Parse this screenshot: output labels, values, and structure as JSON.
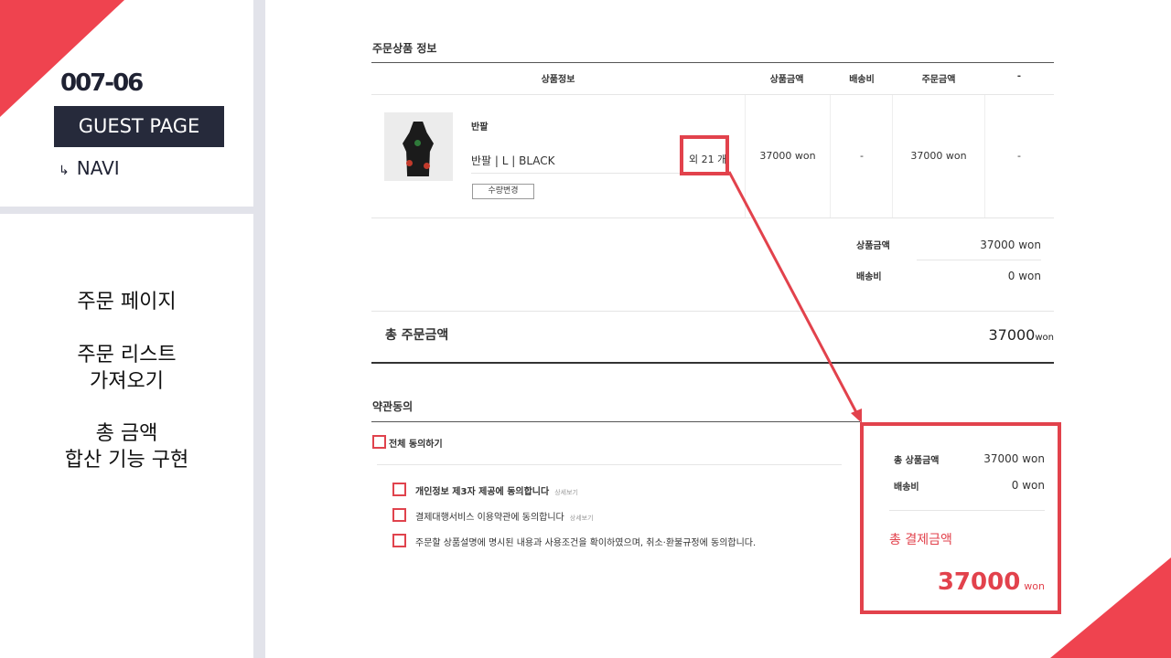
{
  "slide": {
    "code": "007-06",
    "badge": "GUEST PAGE",
    "navi": "NAVI",
    "desc": [
      "주문 페이지",
      "주문 리스트\n가져오기",
      "총 금액\n합산 기능 구현"
    ]
  },
  "order": {
    "section_title": "주문상품 정보",
    "headers": [
      "상품정보",
      "상품금액",
      "배송비",
      "주문금액",
      "-"
    ],
    "item": {
      "name": "반팔",
      "option": "반팔 | L | BLACK",
      "extra_qty": "외 21 개",
      "qty_button": "수량변경",
      "price": "37000 won",
      "shipping": "-",
      "order_price": "37000 won",
      "last_col": "-"
    },
    "summary": {
      "product_label": "상품금액",
      "product_value": "37000 won",
      "ship_label": "배송비",
      "ship_value": "0 won"
    },
    "total_label": "총 주문금액",
    "total_value": "37000",
    "total_unit": "won"
  },
  "agreement": {
    "title": "약관동의",
    "all_label": "전체 동의하기",
    "items": [
      {
        "label": "개인정보 제3자 제공에 동의합니다",
        "detail": "상세보기",
        "bold": true
      },
      {
        "label": "결제대행서비스 이용약관에 동의합니다",
        "detail": "상세보기",
        "bold": false
      },
      {
        "label": "주문할 상품설명에 명시된 내용과 사용조건을 확이하였으며, 취소·환불규정에 동의합니다.",
        "detail": "",
        "bold": false
      }
    ]
  },
  "payment": {
    "product_label": "총 상품금액",
    "product_value": "37000 won",
    "ship_label": "배송비",
    "ship_value": "0 won",
    "total_label": "총 결제금액",
    "total_value": "37000",
    "total_unit": "won"
  },
  "colors": {
    "accent": "#e2424c",
    "navy": "#262a3b",
    "panel": "#e2e3ea"
  }
}
